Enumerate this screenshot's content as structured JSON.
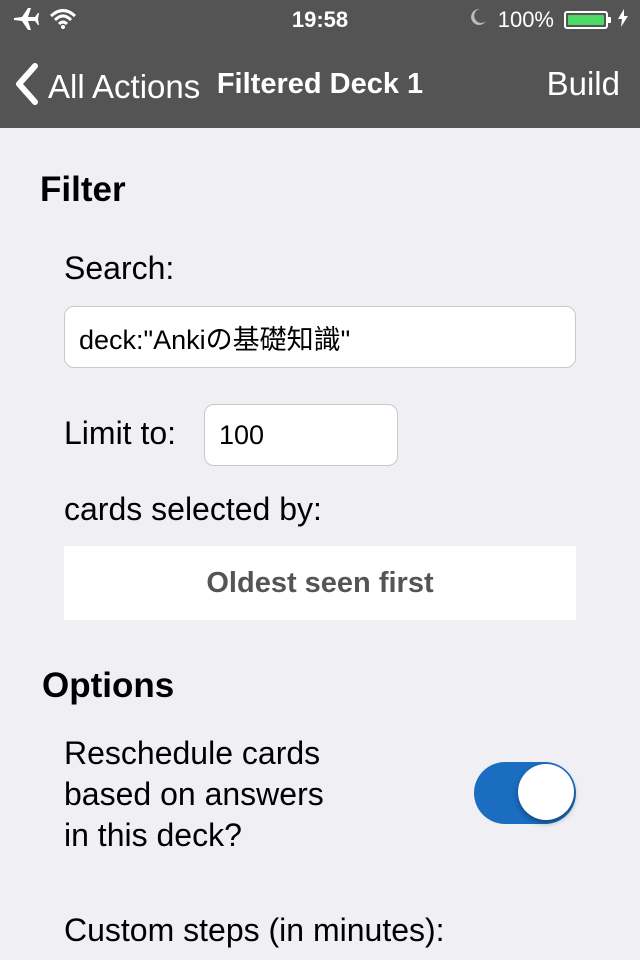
{
  "status_bar": {
    "time": "19:58",
    "battery_percent": "100%",
    "battery_level": 1.0,
    "icons": [
      "airplane-icon",
      "wifi-icon",
      "moon-icon",
      "battery-icon",
      "charging-bolt-icon"
    ]
  },
  "nav": {
    "back_label": "All Actions",
    "title": "Filtered Deck 1",
    "build_label": "Build"
  },
  "filter": {
    "section_title": "Filter",
    "search_label": "Search:",
    "search_value": "deck:\"Ankiの基礎知識\"",
    "limit_label": "Limit to:",
    "limit_value": "100",
    "selected_by_label": "cards selected by:",
    "order_value": "Oldest seen first"
  },
  "options": {
    "section_title": "Options",
    "reschedule_label_lines": [
      "Reschedule cards",
      "based on answers",
      "in this deck?"
    ],
    "reschedule_on": true,
    "custom_steps_label": "Custom steps (in minutes):"
  },
  "colors": {
    "bar_background": "#545454",
    "page_background": "#efeff4",
    "toggle_on": "#1b6dc1",
    "battery_fill": "#4cd964"
  }
}
